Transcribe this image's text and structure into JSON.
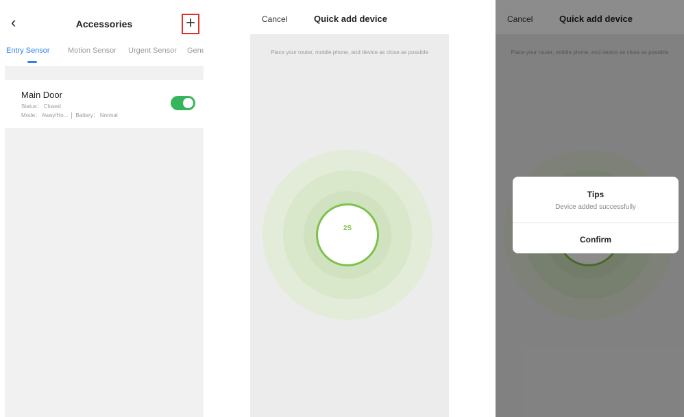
{
  "accessories_screen": {
    "title": "Accessories",
    "back_icon": "chevron-left-icon",
    "add_icon": "plus-icon",
    "tabs": [
      {
        "label": "Entry Sensor",
        "active": true
      },
      {
        "label": "Motion Sensor",
        "active": false
      },
      {
        "label": "Urgent Sensor",
        "active": false
      },
      {
        "label": "Gene",
        "active": false
      }
    ],
    "device": {
      "name": "Main Door",
      "status": "Status： Closed",
      "mode": "Mode： Away/Ho...",
      "battery": "Battery： Normal",
      "enabled": true
    }
  },
  "quick_add_screen": {
    "cancel_label": "Cancel",
    "title": "Quick add device",
    "hint": "Place your router, mobile phone, and device as close as possible",
    "timer": "2S"
  },
  "success_screen": {
    "cancel_label": "Cancel",
    "title": "Quick add device",
    "hint": "Place your router, mobile phone, and device as close as possible",
    "dialog": {
      "title": "Tips",
      "message": "Device added successfully",
      "confirm_label": "Confirm"
    }
  },
  "colors": {
    "accent_blue": "#2f80ed",
    "toggle_green": "#37b55c",
    "radar_green": "#7cc24a",
    "highlight_red": "#e0302a"
  }
}
